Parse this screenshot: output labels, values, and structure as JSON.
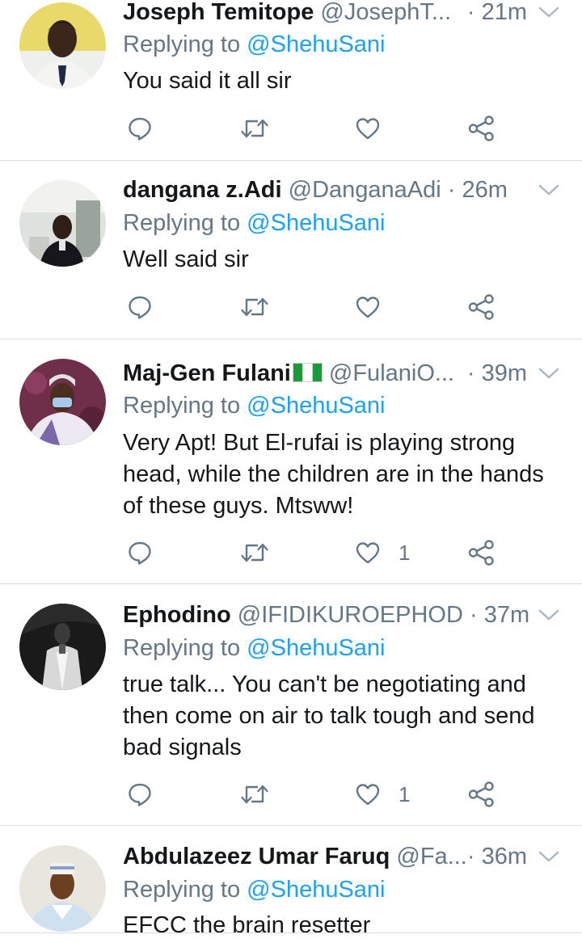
{
  "colors": {
    "accent": "#1da1f2",
    "muted": "#657786",
    "text": "#14171a",
    "divider": "#d9dde0"
  },
  "replies": [
    {
      "name": "Joseph Temitope",
      "handle": "@JosephT...",
      "time": "· 21m",
      "replying_label": "Replying to",
      "mention": "@ShehuSani",
      "text": "You said it all sir",
      "likes": "",
      "avatar_icon": "person-photo-avatar"
    },
    {
      "name": "dangana z.Adi",
      "handle": "@DanganaAdi",
      "time": "· 26m",
      "replying_label": "Replying to",
      "mention": "@ShehuSani",
      "text": "Well said sir",
      "likes": "",
      "avatar_icon": "person-photo-avatar"
    },
    {
      "name": "Maj-Gen Fulani",
      "flag_icon": "nigeria-flag-icon",
      "handle": "@FulaniO...",
      "time": "· 39m",
      "replying_label": "Replying to",
      "mention": "@ShehuSani",
      "text": "Very Apt! But El-rufai is playing strong head, while the children are in the hands of these guys. Mtsww!",
      "likes": "1",
      "avatar_icon": "person-photo-avatar"
    },
    {
      "name": "Ephodino",
      "handle": "@IFIDIKUROEPHOD",
      "time": "· 37m",
      "replying_label": "Replying to",
      "mention": "@ShehuSani",
      "text": "true talk... You can't be negotiating and then come on air to talk tough and send bad signals",
      "likes": "1",
      "avatar_icon": "person-photo-avatar"
    },
    {
      "name": "Abdulazeez Umar Faruq",
      "handle": "@Fa...",
      "time": "· 36m",
      "replying_label": "Replying to",
      "mention": "@ShehuSani",
      "text": "EFCC the brain resetter",
      "likes": "",
      "avatar_icon": "person-photo-avatar"
    }
  ]
}
